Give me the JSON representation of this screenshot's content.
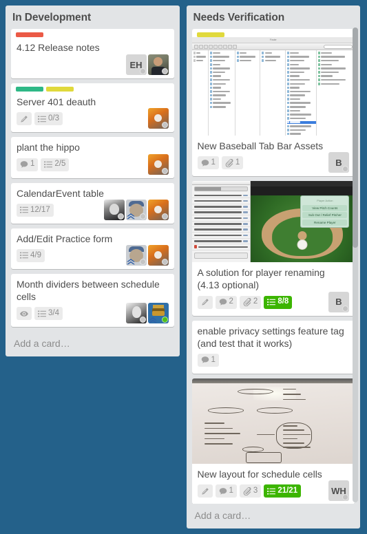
{
  "board": {
    "background_color": "#24618a",
    "list_background": "#e2e4e6",
    "card_background": "#ffffff"
  },
  "label_colors": {
    "red": "#eb5a46",
    "green": "#3cb500",
    "green_soft": "#2eb886",
    "yellow": "#dfd23c",
    "yellow_soft": "#e0d93c"
  },
  "lists": [
    {
      "title": "In Development",
      "add_card_label": "Add a card…",
      "cards": [
        {
          "title": "4.12 Release notes",
          "labels": [
            "red"
          ],
          "badges": [],
          "members": [
            {
              "type": "initials",
              "text": "EH",
              "status": "offline"
            },
            {
              "type": "photo",
              "style": "ph-suit",
              "status": "offline"
            }
          ]
        },
        {
          "title": "Server 401 deauth",
          "labels": [
            "green_soft",
            "yellow_soft"
          ],
          "badges": [
            {
              "icon": "description-icon",
              "text": ""
            },
            {
              "icon": "checklist-icon",
              "text": "0/3"
            }
          ],
          "members": [
            {
              "type": "photo",
              "style": "ph-coffee",
              "status": "offline"
            }
          ]
        },
        {
          "title": "plant the hippo",
          "labels": [],
          "badges": [
            {
              "icon": "comment-icon",
              "text": "1"
            },
            {
              "icon": "checklist-icon",
              "text": "2/5"
            }
          ],
          "members": [
            {
              "type": "photo",
              "style": "ph-coffee",
              "status": "offline"
            }
          ]
        },
        {
          "title": "CalendarEvent table",
          "labels": [],
          "badges": [
            {
              "icon": "checklist-icon",
              "text": "12/17"
            }
          ],
          "members": [
            {
              "type": "photo",
              "style": "ph-bw",
              "status": "offline"
            },
            {
              "type": "photo",
              "style": "ph-bear",
              "status": "offline",
              "mark": true
            },
            {
              "type": "photo",
              "style": "ph-coffee",
              "status": "offline"
            }
          ]
        },
        {
          "title": "Add/Edit Practice form",
          "labels": [],
          "badges": [
            {
              "icon": "checklist-icon",
              "text": "4/9"
            }
          ],
          "members": [
            {
              "type": "photo",
              "style": "ph-bear",
              "status": "offline",
              "mark": true
            },
            {
              "type": "photo",
              "style": "ph-coffee",
              "status": "offline"
            }
          ]
        },
        {
          "title": "Month dividers between schedule cells",
          "labels": [],
          "badges": [
            {
              "icon": "watch-icon",
              "text": ""
            },
            {
              "icon": "checklist-icon",
              "text": "3/4"
            }
          ],
          "members": [
            {
              "type": "photo",
              "style": "ph-bwman",
              "status": "offline"
            },
            {
              "type": "photo",
              "style": "ph-pixel",
              "status": "online",
              "mark": true
            }
          ]
        }
      ]
    },
    {
      "title": "Needs Verification",
      "add_card_label": "Add a card…",
      "has_scrollbar": true,
      "cards": [
        {
          "title": "New Baseball Tab Bar Assets",
          "labels": [
            "yellow_soft"
          ],
          "cover": "finder-screenshot",
          "badges": [
            {
              "icon": "comment-icon",
              "text": "1"
            },
            {
              "icon": "attachment-icon",
              "text": "1"
            }
          ],
          "members": [
            {
              "type": "initials",
              "text": "B",
              "status": "offline"
            }
          ]
        },
        {
          "title": "A solution for player renaming (4.13 optional)",
          "labels": [],
          "cover": "baseball-app-screenshot",
          "badges": [
            {
              "icon": "description-icon",
              "text": ""
            },
            {
              "icon": "comment-icon",
              "text": "2"
            },
            {
              "icon": "attachment-icon",
              "text": "2"
            },
            {
              "icon": "checklist-icon",
              "text": "8/8",
              "complete": true
            }
          ],
          "members": [
            {
              "type": "initials",
              "text": "B",
              "status": "offline"
            }
          ]
        },
        {
          "title": "enable privacy settings feature tag (and test that it works)",
          "labels": [],
          "badges": [
            {
              "icon": "comment-icon",
              "text": "1"
            }
          ],
          "members": []
        },
        {
          "title": "New layout for schedule cells",
          "labels": [],
          "cover": "whiteboard-photo",
          "badges": [
            {
              "icon": "description-icon",
              "text": ""
            },
            {
              "icon": "comment-icon",
              "text": "1"
            },
            {
              "icon": "attachment-icon",
              "text": "3"
            },
            {
              "icon": "checklist-icon",
              "text": "21/21",
              "complete": true
            }
          ],
          "members": [
            {
              "type": "initials",
              "text": "WH",
              "status": "offline"
            }
          ]
        },
        {
          "title": "",
          "labels": [
            "yellow_soft"
          ],
          "partial": true,
          "badges": [],
          "members": []
        }
      ]
    }
  ]
}
